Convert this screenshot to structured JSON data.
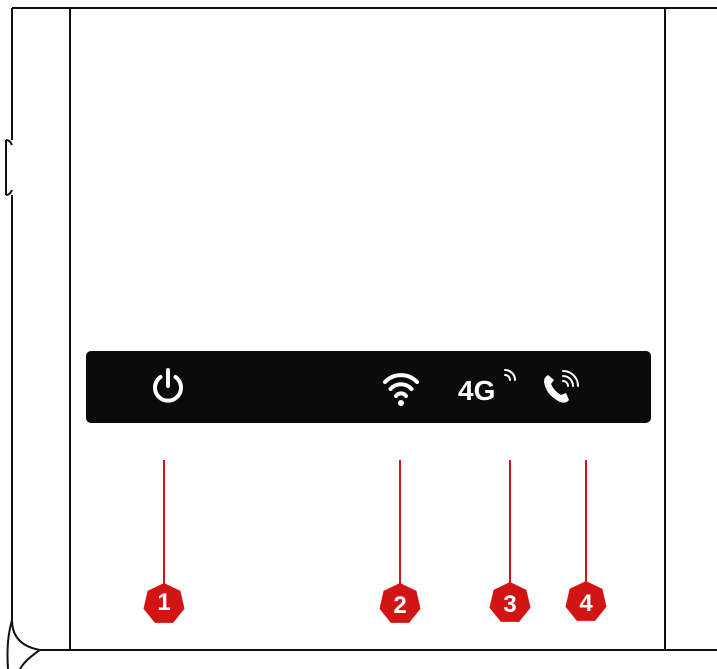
{
  "indicator_panel": {
    "icons": [
      {
        "id": 1,
        "icon": "power-icon"
      },
      {
        "id": 2,
        "icon": "wifi-icon"
      },
      {
        "id": 3,
        "icon": "4g-icon",
        "label": "4G"
      },
      {
        "id": 4,
        "icon": "phone-icon"
      }
    ]
  },
  "callouts": [
    {
      "number": "1"
    },
    {
      "number": "2"
    },
    {
      "number": "3"
    },
    {
      "number": "4"
    }
  ],
  "colors": {
    "outline": "#111111",
    "panel": "#0b0b0b",
    "icon": "#ffffff",
    "callout": "#d21414"
  }
}
